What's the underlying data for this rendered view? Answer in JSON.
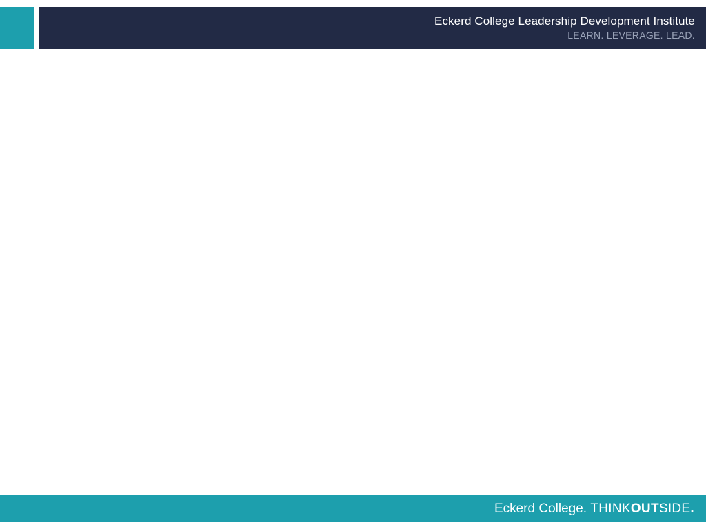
{
  "header": {
    "title": "Eckerd College Leadership Development Institute",
    "tagline": "LEARN. LEVERAGE. LEAD."
  },
  "footer": {
    "college": "Eckerd College.",
    "think": "THINK",
    "out": "OUT",
    "side": "SIDE",
    "period": "."
  },
  "colors": {
    "teal": "#1d9fad",
    "navy": "#222a45",
    "tagline_gray": "#9aa3b8"
  }
}
